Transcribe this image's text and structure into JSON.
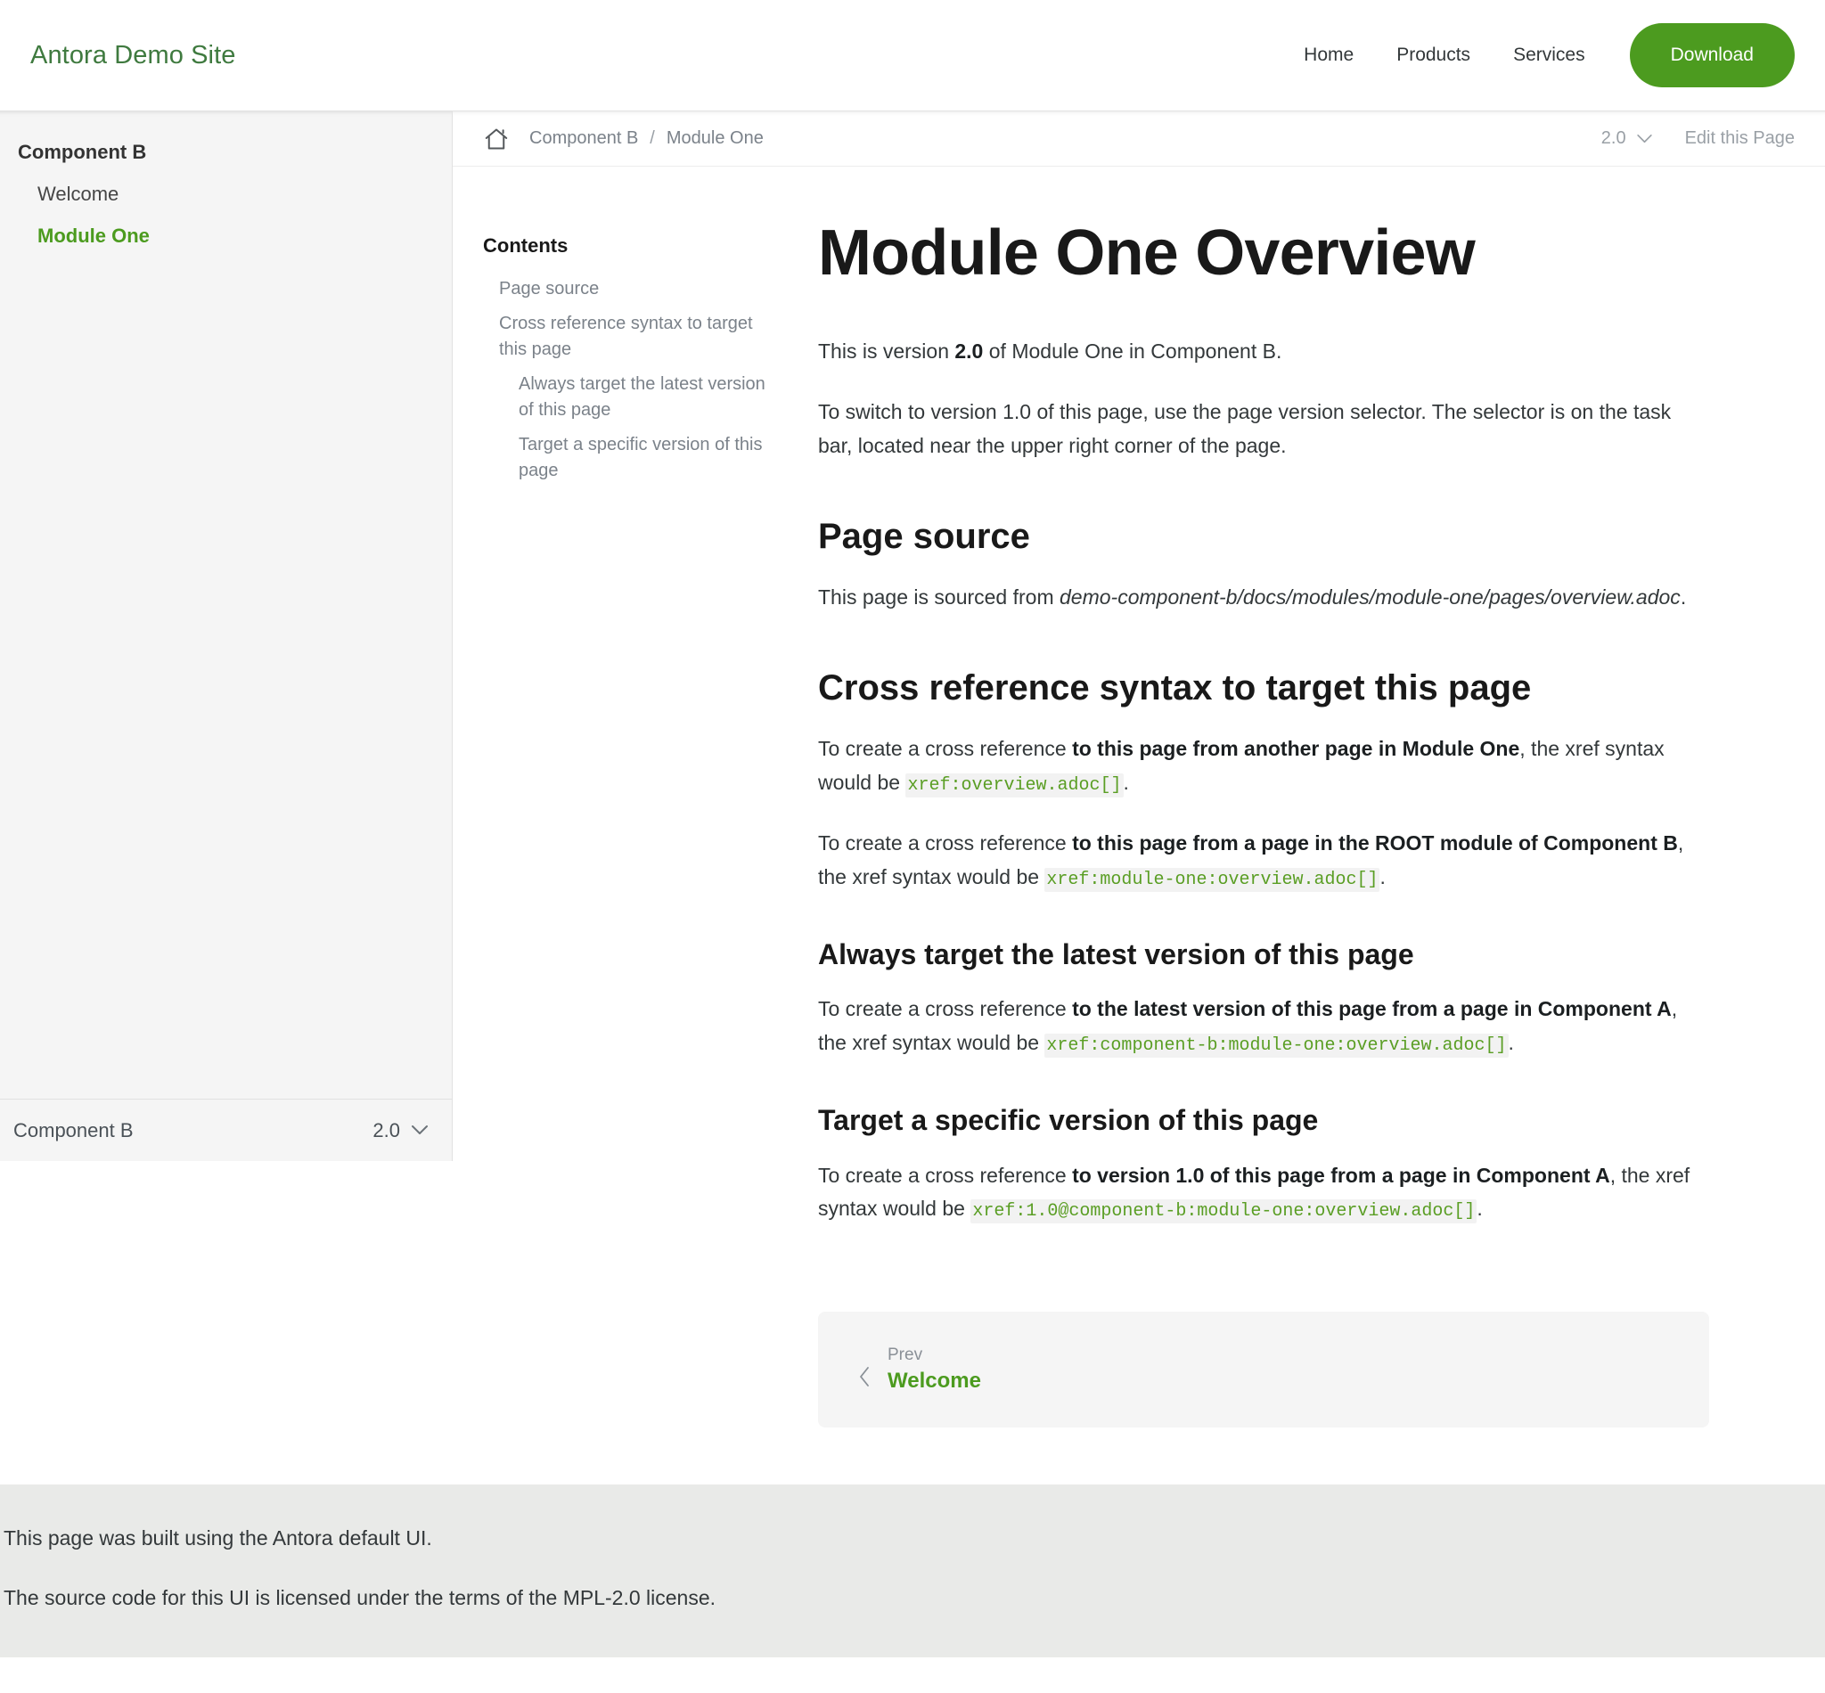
{
  "navbar": {
    "brand": "Antora Demo Site",
    "links": [
      {
        "label": "Home"
      },
      {
        "label": "Products"
      },
      {
        "label": "Services"
      }
    ],
    "download_label": "Download"
  },
  "sidebar": {
    "component_title": "Component B",
    "items": [
      {
        "label": "Welcome",
        "current": false
      },
      {
        "label": "Module One",
        "current": true
      }
    ],
    "footer": {
      "component": "Component B",
      "version": "2.0",
      "chevron": "chevron-down-icon"
    }
  },
  "toolbar": {
    "home_icon": "home-icon",
    "breadcrumbs": [
      {
        "label": "Component B"
      },
      {
        "label": "Module One"
      }
    ],
    "separator": "/",
    "page_version": "2.0",
    "edit_label": "Edit this Page"
  },
  "toc": {
    "title": "Contents",
    "items": [
      {
        "label": "Page source",
        "level": 2
      },
      {
        "label": "Cross reference syntax to target this page",
        "level": 2
      },
      {
        "label": "Always target the latest version of this page",
        "level": 3
      },
      {
        "label": "Target a specific version of this page",
        "level": 3
      }
    ]
  },
  "doc": {
    "title": "Module One Overview",
    "intro": {
      "p1_before": "This is version ",
      "p1_strong": "2.0",
      "p1_after": " of Module One in Component B.",
      "p2": "To switch to version 1.0 of this page, use the page version selector. The selector is on the task bar, located near the upper right corner of the page."
    },
    "page_source": {
      "heading": "Page source",
      "p_before": "This page is sourced from ",
      "p_em": "demo-component-b/docs/modules/module-one/pages/overview.adoc",
      "p_after": "."
    },
    "xref": {
      "heading": "Cross reference syntax to target this page",
      "p1_before": "To create a cross reference ",
      "p1_strong": "to this page from another page in Module One",
      "p1_mid": ", the xref syntax would be ",
      "p1_code": "xref:overview.adoc[]",
      "p1_after": ".",
      "p2_before": "To create a cross reference ",
      "p2_strong": "to this page from a page in the ROOT module of Component B",
      "p2_mid": ", the xref syntax would be ",
      "p2_code": "xref:module-one:overview.adoc[]",
      "p2_after": "."
    },
    "latest": {
      "heading": "Always target the latest version of this page",
      "p_before": "To create a cross reference ",
      "p_strong": "to the latest version of this page from a page in Component A",
      "p_mid": ", the xref syntax would be ",
      "p_code": "xref:component-b:module-one:overview.adoc[]",
      "p_after": "."
    },
    "specific": {
      "heading": "Target a specific version of this page",
      "p_before": "To create a cross reference ",
      "p_strong": "to version 1.0 of this page from a page in Component A",
      "p_mid": ", the xref syntax would be ",
      "p_code": "xref:1.0@component-b:module-one:overview.adoc[]",
      "p_after": "."
    },
    "pagination": {
      "prev_label": "Prev",
      "prev_title": "Welcome",
      "chevron": "chevron-left-icon"
    }
  },
  "footer": {
    "line1": "This page was built using the Antora default UI.",
    "line2_before": "The source code for this UI is licensed under the terms of the ",
    "line2_link": "MPL-2.0 license",
    "line2_after": "."
  },
  "colors": {
    "brand_green": "#3f7a3f",
    "accent_green": "#4c9b1f",
    "code_green": "#5a9e24",
    "text": "#33383a",
    "muted": "#7b828a",
    "sidebar_bg": "#f5f5f5",
    "footer_bg": "#e9eae8"
  }
}
